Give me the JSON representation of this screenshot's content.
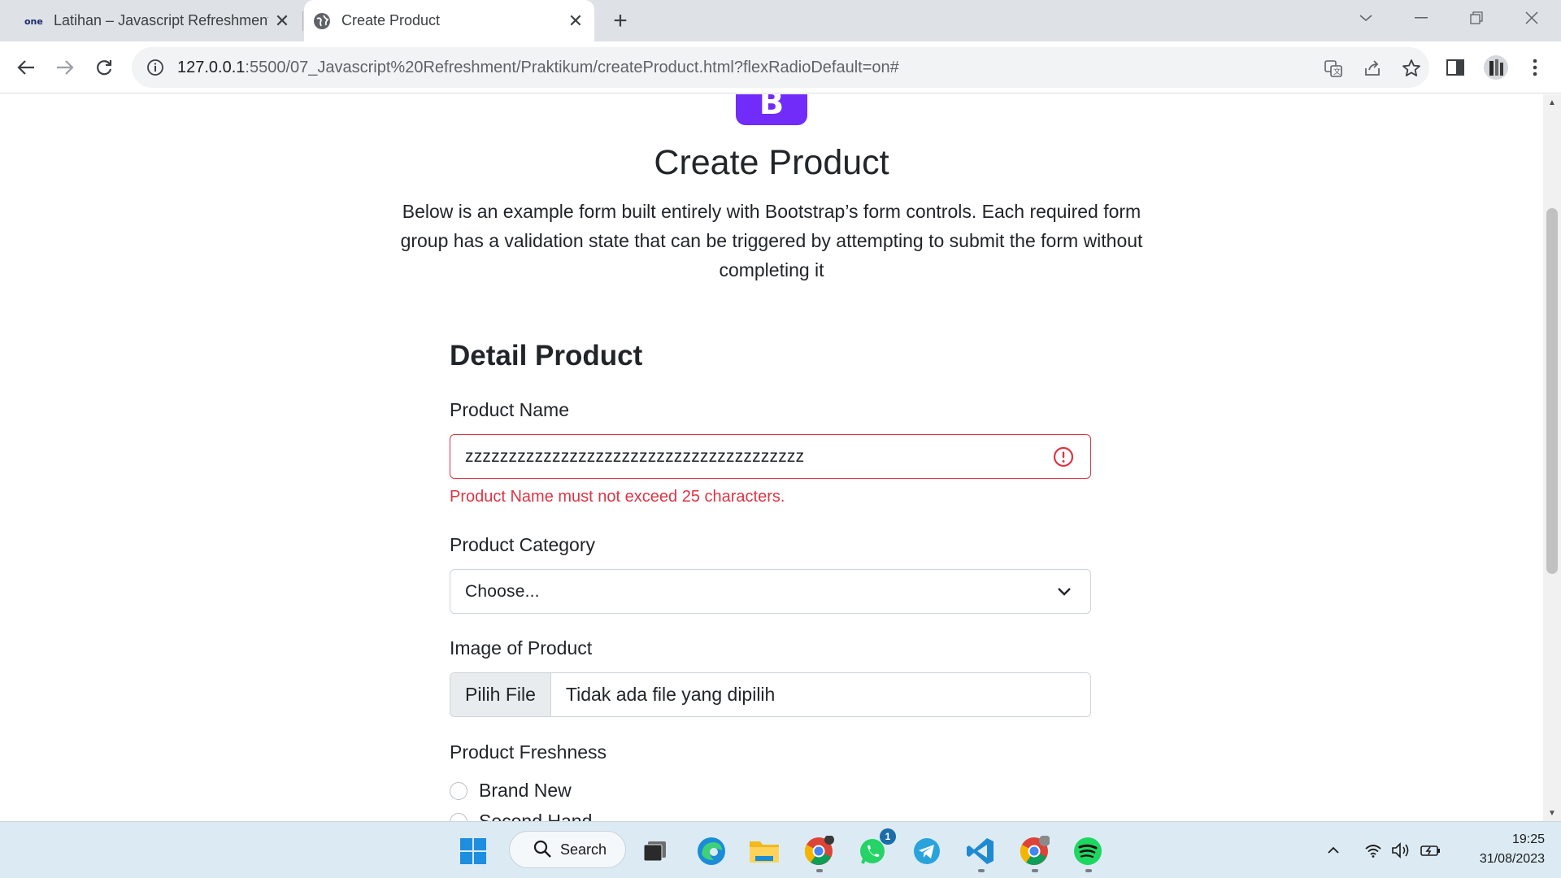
{
  "browser": {
    "tabs": [
      {
        "label": "Latihan – Javascript Refreshment",
        "active": false,
        "favicon": "one-logo-icon"
      },
      {
        "label": "Create Product",
        "active": true,
        "favicon": "globe-icon"
      }
    ],
    "url_host": "127.0.0.1",
    "url_rest": ":5500/07_Javascript%20Refreshment/Praktikum/createProduct.html?flexRadioDefault=on#"
  },
  "page": {
    "logo_letter": "B",
    "title": "Create Product",
    "lead": "Below is an example form built entirely with Bootstrap’s form controls. Each required form group has a validation state that can be triggered by attempting to submit the form without completing it",
    "section_title": "Detail Product",
    "product_name": {
      "label": "Product Name",
      "value": "zzzzzzzzzzzzzzzzzzzzzzzzzzzzzzzzzzzzzzz",
      "error": "Product Name must not exceed 25 characters."
    },
    "product_category": {
      "label": "Product Category",
      "selected": "Choose..."
    },
    "image": {
      "label": "Image of Product",
      "button": "Pilih File",
      "status": "Tidak ada file yang dipilih"
    },
    "freshness": {
      "label": "Product Freshness",
      "options": [
        "Brand New",
        "Second Hand"
      ]
    }
  },
  "taskbar": {
    "search_label": "Search",
    "whatsapp_badge": "1",
    "time": "19:25",
    "date": "31/08/2023"
  },
  "colors": {
    "accent": "#712cf9",
    "danger": "#dc3545"
  }
}
